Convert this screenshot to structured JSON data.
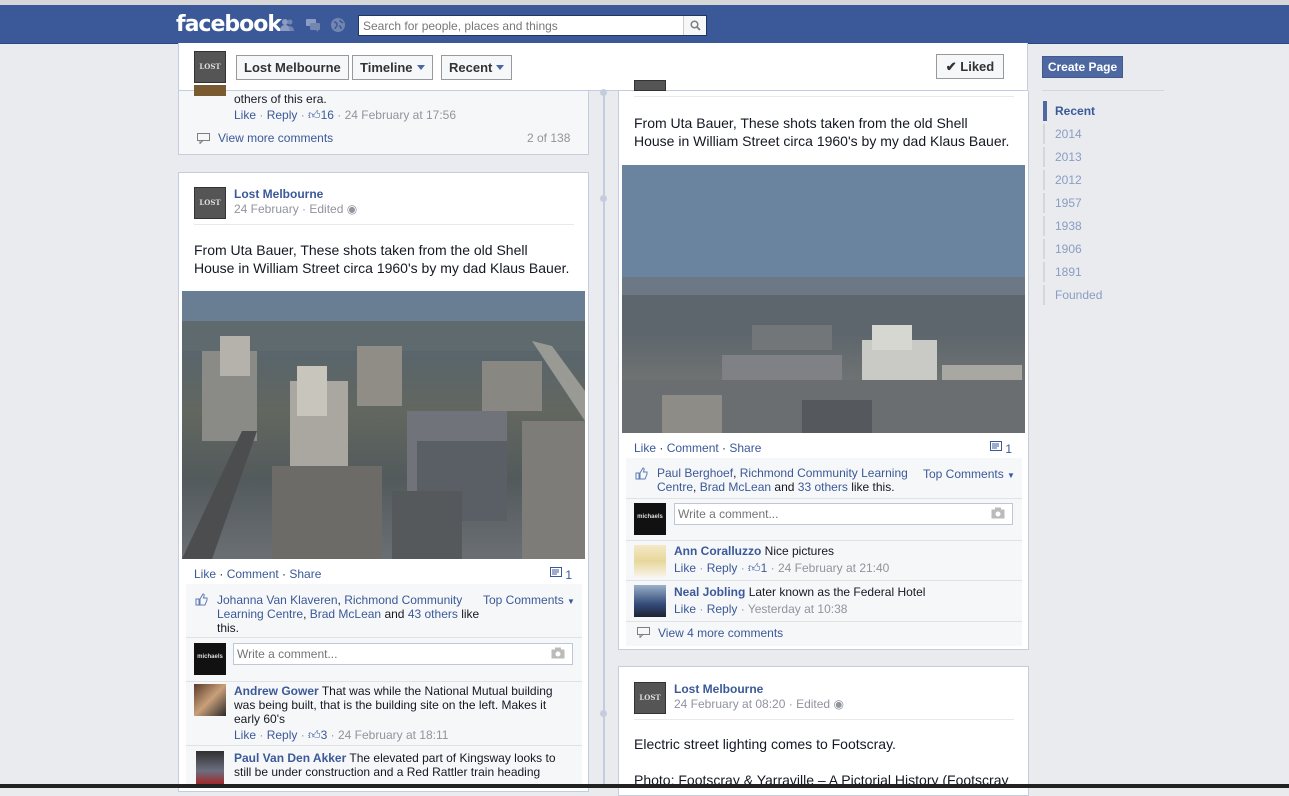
{
  "topbar": {
    "logo": "facebook",
    "search_placeholder": "Search for people, places and things"
  },
  "pagebar": {
    "page_name": "Lost Melbourne",
    "timeline": "Timeline",
    "recent": "Recent",
    "liked": "✔ Liked"
  },
  "right_sidebar": {
    "create_page": "Create Page",
    "years": [
      "Recent",
      "2014",
      "2013",
      "2012",
      "1957",
      "1938",
      "1906",
      "1891",
      "Founded"
    ]
  },
  "post_top_left": {
    "comment_text": "others of this era.",
    "like": "Like",
    "reply": "Reply",
    "likes_count": "16",
    "time": "24 February at 17:56",
    "view_more": "View more comments",
    "count": "2 of 138"
  },
  "post_left": {
    "author": "Lost Melbourne",
    "date": "24 February",
    "edited": "Edited",
    "text_line1": "From Uta Bauer, These shots taken from the old Shell",
    "text_line2": "House in William Street circa 1960's by my dad Klaus Bauer.",
    "actions": {
      "like": "Like",
      "comment": "Comment",
      "share": "Share",
      "comment_count": "1"
    },
    "likers": {
      "name1": "Johanna Van Klaveren",
      "name2a": "Richmond Community",
      "name2b": "Learning Centre",
      "name3": "Brad McLean",
      "and": "and",
      "others": "43 others",
      "tail": "like this."
    },
    "top_comments": "Top Comments",
    "write_placeholder": "Write a comment...",
    "comments": [
      {
        "name": "Andrew Gower",
        "text1": "That was while the National Mutual building",
        "text2": "was being built, that is the building site on the left. Makes it",
        "text3": "early 60's",
        "like": "Like",
        "reply": "Reply",
        "likes": "3",
        "time": "24 February at 18:11"
      },
      {
        "name": "Paul Van Den Akker",
        "text1": "The elevated part of Kingsway looks to",
        "text2": "still be under construction and a Red Rattler train heading"
      }
    ]
  },
  "post_right": {
    "text_line1": "From Uta Bauer, These shots taken from the old Shell",
    "text_line2": "House in William Street circa 1960's by my dad Klaus Bauer.",
    "actions": {
      "like": "Like",
      "comment": "Comment",
      "share": "Share",
      "comment_count": "1"
    },
    "likers": {
      "name1": "Paul Berghoef",
      "name2": "Richmond Community Learning",
      "name2b": "Centre",
      "name3": "Brad McLean",
      "and": "and",
      "others": "33 others",
      "tail": "like this."
    },
    "top_comments": "Top Comments",
    "write_placeholder": "Write a comment...",
    "comments": [
      {
        "name": "Ann Coralluzzo",
        "text": "Nice pictures",
        "like": "Like",
        "reply": "Reply",
        "likes": "1",
        "time": "24 February at 21:40"
      },
      {
        "name": "Neal Jobling",
        "text": "Later known as the Federal Hotel",
        "like": "Like",
        "reply": "Reply",
        "time": "Yesterday at 10:38"
      }
    ],
    "view_more": "View 4 more comments"
  },
  "post_bottom_right": {
    "author": "Lost Melbourne",
    "date": "24 February at 08:20",
    "edited": "Edited",
    "text": "Electric street lighting comes to Footscray.",
    "text2": "Photo: Footscray & Yarraville – A Pictorial History (Footscray"
  },
  "thumb_label": "LOST",
  "avatar_label": "michaels"
}
